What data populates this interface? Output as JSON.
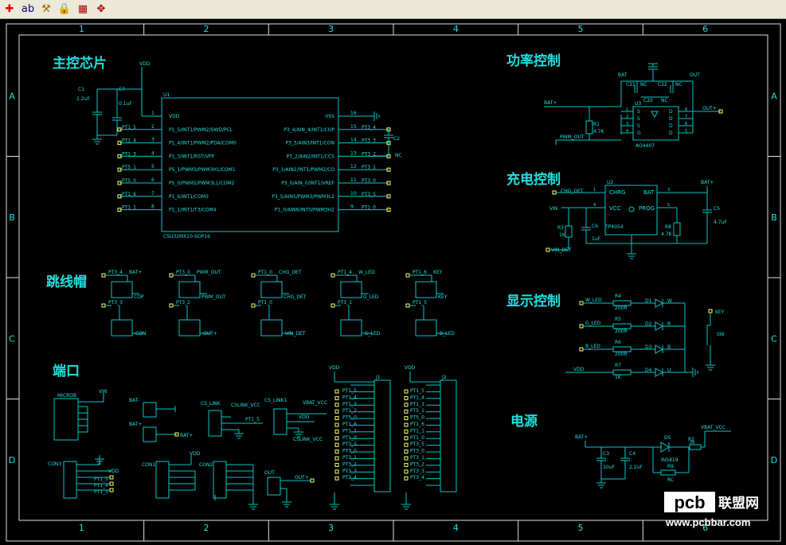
{
  "toolbar": {
    "icons": [
      "pin-icon",
      "text-icon",
      "tools-icon",
      "lock-icon",
      "chart-icon",
      "component-icon"
    ],
    "glyphs": [
      "✚",
      "ab",
      "⚒",
      "🔒",
      "▦",
      "✥"
    ]
  },
  "frame": {
    "cols": [
      "1",
      "2",
      "3",
      "4",
      "5",
      "6"
    ],
    "rows": [
      "A",
      "B",
      "C",
      "D"
    ]
  },
  "sections": {
    "main_ctrl": "主控芯片",
    "power_ctrl": "功率控制",
    "charge_ctrl": "充电控制",
    "jumper": "跳线帽",
    "display_ctrl": "显示控制",
    "port": "端口",
    "power_supply": "电源"
  },
  "mcu": {
    "ref": "U1",
    "part": "CSU32MX10-SOP16",
    "vdd": "VDD",
    "c1": "C1",
    "c1v": "2.2uF",
    "c7": "C7",
    "c7v": "0.1uF",
    "left_pins": [
      {
        "num": "1",
        "name": "VDD",
        "net": ""
      },
      {
        "num": "2",
        "name": "P1_5/INT1/PWM2/SWD/PCL",
        "net": "PT1_5"
      },
      {
        "num": "3",
        "name": "P1_4/INT1/PWM2/PDA/COM0",
        "net": "PT1_4"
      },
      {
        "num": "4",
        "name": "P1_3/INT1/RST/VPP",
        "net": "PT1_3"
      },
      {
        "num": "5",
        "name": "P5_1/PWM3/PWM3H1/COM1",
        "net": "PT5_1"
      },
      {
        "num": "6",
        "name": "P5_0/PWM2/PWM3L1/COM2",
        "net": "PT5_0"
      },
      {
        "num": "7",
        "name": "P1_6/INT1/COM3",
        "net": "PT1_6"
      },
      {
        "num": "8",
        "name": "P1_1/INT1/T3/COM4",
        "net": "PT1_1"
      }
    ],
    "right_pins": [
      {
        "num": "16",
        "name": "VSS",
        "net": ""
      },
      {
        "num": "15",
        "name": "P3_4/AIN_4/INT1/COP",
        "net": "PT3_4"
      },
      {
        "num": "14",
        "name": "P3_3/AIN3/INT1/CON",
        "net": "PT3_3"
      },
      {
        "num": "13",
        "name": "P3_2/AIN2/INT1/CCS",
        "net": "PT3_2"
      },
      {
        "num": "12",
        "name": "P3_1/AIN1/INT1/PWM2/CO",
        "net": "PT3_1"
      },
      {
        "num": "11",
        "name": "P3_0/AIN_0/INT1/VREF",
        "net": "PT3_0"
      },
      {
        "num": "10",
        "name": "P3_5/AIN5/PWM3/PWM3L2",
        "net": "PT3_5"
      },
      {
        "num": "9",
        "name": "P1_0/AIN6/INT0/PWM3H2",
        "net": "PT1_0"
      }
    ],
    "c2": "C2",
    "c2v": "NC"
  },
  "power": {
    "bat_plus": "BAT+",
    "bat": "BAT",
    "out": "OUT",
    "out_plus": "OUT+",
    "c21": "C21",
    "c22": "C22",
    "c20": "C20",
    "nc": "NC",
    "u3": "U3",
    "u3part": "AO4407",
    "r1": "R1",
    "r1v": "4.7K",
    "pwm_out": "PWM_OUT",
    "pins_s": [
      "S",
      "S",
      "S",
      "G"
    ],
    "pins_d": [
      "D",
      "D",
      "D",
      "D"
    ],
    "pn_l": [
      "1",
      "2",
      "3",
      "4"
    ],
    "pn_r": [
      "8",
      "7",
      "6",
      "5"
    ]
  },
  "charge": {
    "u2": "U2",
    "part": "TP4054",
    "chg_det": "CHG_DET",
    "chrg": "CHRG",
    "bat": "BAT",
    "vcc": "VCC",
    "prog": "PROG",
    "bat_plus": "BAT+",
    "vin": "VIN",
    "vin_det": "VIN_DET",
    "r3": "R3",
    "r3v": "1K",
    "c6": "C6",
    "c6v": "1uF",
    "r8": "R8",
    "r8v": "4.7K",
    "c5": "C5",
    "c5v": "4.7uF",
    "p1": "1",
    "p3": "3",
    "p4": "4",
    "p5": "5"
  },
  "jumpers": [
    {
      "top": "PT3_4",
      "topR": "BAT+",
      "mid": "PT3_3",
      "midR": "COP",
      "bot": "CON"
    },
    {
      "top": "PT3_0",
      "topR": "PWM_OUT",
      "mid": "PT3_2",
      "midR": "PWM_OUT",
      "bot": "OUT+"
    },
    {
      "top": "PT1_0",
      "topR": "CHG_DET",
      "mid": "PT1_0",
      "midR": "CHG_DET",
      "bot": "VIN_DET"
    },
    {
      "top": "PT1_4",
      "topR": "W_LED",
      "mid": "PT3_1",
      "midR": "G_LED",
      "bot": "G_LED"
    },
    {
      "top": "PT1_6",
      "topR": "KEY",
      "mid": "PT1_5",
      "midR": "KEY",
      "bot": "B_LED"
    }
  ],
  "display": {
    "leds": [
      {
        "net": "W_LED",
        "r": "R4",
        "rv": "200R",
        "d": "D1",
        "c": "W"
      },
      {
        "net": "G_LED",
        "r": "R5",
        "rv": "200R",
        "d": "D2",
        "c": "R"
      },
      {
        "net": "B_LED",
        "r": "R6",
        "rv": "200R",
        "d": "D3",
        "c": "B"
      },
      {
        "net": "VDD",
        "r": "R7",
        "rv": "1K",
        "d": "D4",
        "c": "U"
      }
    ],
    "key": "KEY",
    "sw": "SW"
  },
  "ports": {
    "micro": "MICROB",
    "vin": "VIN",
    "bat1": "BAT-",
    "bat2": "BAT+",
    "bat2r": "BAT+",
    "cslink": "CS_LINK",
    "cslink_vcc": "CSLINK_VCC",
    "cslink1": "CS_LINK1",
    "vbat_vcc": "VBAT_VCC",
    "vdd": "VDD",
    "pt15": "PT1_5",
    "con3": "CON3",
    "con1": "CON1",
    "con2": "CON2",
    "out": "OUT",
    "outp": "OUT+",
    "j1": "J1",
    "j2": "J2",
    "j1_nets": [
      "PT1_5",
      "PT1_4",
      "PT1_3",
      "PT1_2",
      "PT5_0",
      "PT1_6",
      "PT1_1",
      "PT1_0",
      "PT3_5",
      "PT3_0",
      "PT3_1",
      "PT3_2",
      "PT3_3",
      "PT3_4"
    ],
    "j2_nets": [
      "PT1_5",
      "PT1_4",
      "PT1_3",
      "PT5_1",
      "PT5_0",
      "PT1_6",
      "PT1_1",
      "PT1_0",
      "PT3_5",
      "PT3_0",
      "PT3_1",
      "PT3_2",
      "PT3_3",
      "PT3_4"
    ]
  },
  "supply": {
    "bat_plus": "BAT+",
    "c3": "C3",
    "c3v": "10uF",
    "c4": "C4",
    "c4v": "2.2uF",
    "d5": "D5",
    "d5part": "IN5819",
    "r2": "R2",
    "r2v": "2R",
    "r9": "R9",
    "r9v": "RC",
    "vbat_vcc": "VBAT_VCC"
  },
  "watermark": {
    "logo": "pcb",
    "cn": "联盟网",
    "url": "www.pcbbar.com"
  },
  "colors": {
    "wire": "#00c8c8",
    "text": "#20e0e0",
    "frame": "#e0e0e0",
    "pin": "#ffff66",
    "bg": "#000000"
  }
}
